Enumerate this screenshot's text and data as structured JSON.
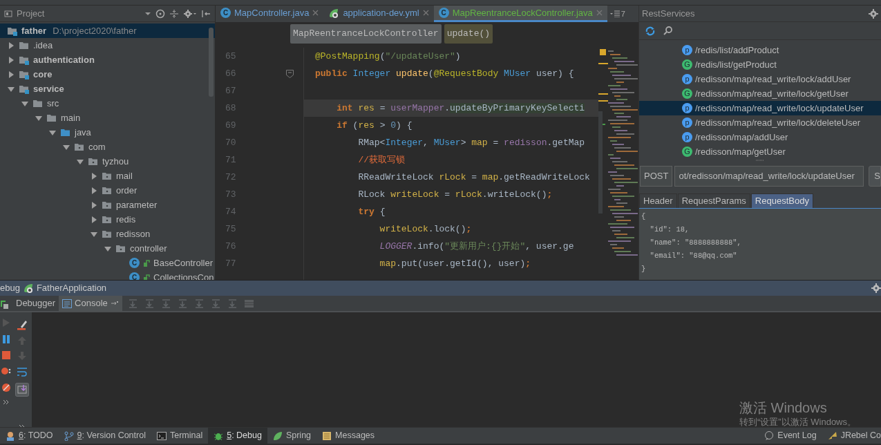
{
  "project_panel": {
    "title": "Project"
  },
  "tree": [
    {
      "label": "father",
      "path": "D:\\project2020\\father",
      "kind": "module",
      "selected": true,
      "children": [
        {
          "label": ".idea",
          "kind": "folder",
          "selected": false,
          "expanded": false
        },
        {
          "label": "authentication",
          "kind": "module",
          "selected": false,
          "expanded": false
        },
        {
          "label": "core",
          "kind": "module",
          "selected": false,
          "expanded": false
        },
        {
          "label": "service",
          "kind": "module",
          "selected": false,
          "expanded": true,
          "children": [
            {
              "label": "src",
              "kind": "folder",
              "selected": false,
              "expanded": true,
              "children": [
                {
                  "label": "main",
                  "kind": "folder",
                  "selected": false,
                  "expanded": true,
                  "children": [
                    {
                      "label": "java",
                      "kind": "source",
                      "selected": false,
                      "expanded": true,
                      "children": [
                        {
                          "label": "com",
                          "kind": "package",
                          "selected": false,
                          "expanded": true,
                          "children": [
                            {
                              "label": "tyzhou",
                              "kind": "package",
                              "selected": false,
                              "expanded": true,
                              "children": [
                                {
                                  "label": "mail",
                                  "kind": "package",
                                  "selected": false,
                                  "expanded": false
                                },
                                {
                                  "label": "order",
                                  "kind": "package",
                                  "selected": false,
                                  "expanded": false
                                },
                                {
                                  "label": "parameter",
                                  "kind": "package",
                                  "selected": false,
                                  "expanded": false
                                },
                                {
                                  "label": "redis",
                                  "kind": "package",
                                  "selected": false,
                                  "expanded": false
                                },
                                {
                                  "label": "redisson",
                                  "kind": "package",
                                  "selected": false,
                                  "expanded": true,
                                  "children": [
                                    {
                                      "label": "controller",
                                      "kind": "package",
                                      "selected": false,
                                      "expanded": true,
                                      "children": [
                                        {
                                          "label": "BaseController",
                                          "kind": "class",
                                          "badge": "C",
                                          "selected": false
                                        },
                                        {
                                          "label": "CollectionsCon",
                                          "kind": "class",
                                          "badge": "C",
                                          "selected": false
                                        }
                                      ]
                                    }
                                  ]
                                }
                              ]
                            }
                          ]
                        }
                      ]
                    }
                  ]
                }
              ]
            }
          ]
        }
      ]
    }
  ],
  "editor_tabs": [
    {
      "label": "MapController.java",
      "kind": "class",
      "badge": "C",
      "color": "#6a9fd4",
      "selected": false
    },
    {
      "label": "application-dev.yml",
      "kind": "spring",
      "color": "#6a9fd4",
      "selected": false
    },
    {
      "label": "MapReentranceLockController.java",
      "kind": "class",
      "badge": "C",
      "color": "#62b543",
      "selected": true
    }
  ],
  "tab_overflow_count": "7",
  "breadcrumbs": [
    {
      "label": "MapReentranceLockController",
      "kind": "class"
    },
    {
      "label": "update()",
      "kind": "method"
    }
  ],
  "code_lines": [
    {
      "number": "65",
      "current": false,
      "fold": false,
      "tokens": [
        {
          "text": "@PostMapping",
          "kind": "ann"
        },
        {
          "text": "(",
          "kind": "plain"
        },
        {
          "text": "\"/updateUser\"",
          "kind": "str"
        },
        {
          "text": ")",
          "kind": "plain"
        }
      ]
    },
    {
      "number": "66",
      "current": false,
      "fold": true,
      "tokens": [
        {
          "text": "public ",
          "kind": "kw"
        },
        {
          "text": "Integer ",
          "kind": "type"
        },
        {
          "text": "update",
          "kind": "method"
        },
        {
          "text": "(",
          "kind": "plain"
        },
        {
          "text": "@RequestBody ",
          "kind": "ann"
        },
        {
          "text": "MUser ",
          "kind": "type"
        },
        {
          "text": "user) {",
          "kind": "plain"
        }
      ]
    },
    {
      "number": "67",
      "current": false,
      "fold": false
    },
    {
      "number": "68",
      "current": true,
      "fold": false,
      "tokens": [
        {
          "text": "    int ",
          "kind": "kw"
        },
        {
          "text": "res",
          "kind": "var"
        },
        {
          "text": " = ",
          "kind": "plain"
        },
        {
          "text": "userMapper",
          "kind": "field"
        },
        {
          "text": ".",
          "kind": "plain"
        },
        {
          "text": "updateByPrimaryKeySelecti",
          "kind": "hl"
        }
      ]
    },
    {
      "number": "69",
      "current": false,
      "fold": false,
      "tokens": [
        {
          "text": "    if ",
          "kind": "kw"
        },
        {
          "text": "(",
          "kind": "plain"
        },
        {
          "text": "res",
          "kind": "var"
        },
        {
          "text": " > ",
          "kind": "plain"
        },
        {
          "text": "0",
          "kind": "num"
        },
        {
          "text": ") {",
          "kind": "plain"
        }
      ]
    },
    {
      "number": "70",
      "current": false,
      "fold": false,
      "tokens": [
        {
          "text": "        RMap<",
          "kind": "plain"
        },
        {
          "text": "Integer",
          "kind": "type"
        },
        {
          "text": ", ",
          "kind": "plain"
        },
        {
          "text": "MUser",
          "kind": "type"
        },
        {
          "text": "> ",
          "kind": "plain"
        },
        {
          "text": "map",
          "kind": "var"
        },
        {
          "text": " = ",
          "kind": "plain"
        },
        {
          "text": "redisson",
          "kind": "field"
        },
        {
          "text": ".getMap",
          "kind": "plain"
        }
      ]
    },
    {
      "number": "71",
      "current": false,
      "fold": false,
      "tokens": [
        {
          "text": "        //获取写锁",
          "kind": "comment"
        }
      ]
    },
    {
      "number": "72",
      "current": false,
      "fold": false,
      "tokens": [
        {
          "text": "        RReadWriteLock ",
          "kind": "plain"
        },
        {
          "text": "rLock",
          "kind": "var"
        },
        {
          "text": " = ",
          "kind": "plain"
        },
        {
          "text": "map",
          "kind": "var"
        },
        {
          "text": ".getReadWriteLock",
          "kind": "plain"
        }
      ]
    },
    {
      "number": "73",
      "current": false,
      "fold": false,
      "tokens": [
        {
          "text": "        RLock ",
          "kind": "plain"
        },
        {
          "text": "writeLock",
          "kind": "var"
        },
        {
          "text": " = ",
          "kind": "plain"
        },
        {
          "text": "rLock",
          "kind": "var"
        },
        {
          "text": ".writeLock()",
          "kind": "plain"
        },
        {
          "text": ";",
          "kind": "kw"
        }
      ]
    },
    {
      "number": "74",
      "current": false,
      "fold": false,
      "tokens": [
        {
          "text": "        try ",
          "kind": "kw"
        },
        {
          "text": "{",
          "kind": "plain"
        }
      ]
    },
    {
      "number": "75",
      "current": false,
      "fold": false,
      "tokens": [
        {
          "text": "            writeLock",
          "kind": "var"
        },
        {
          "text": ".lock()",
          "kind": "plain"
        },
        {
          "text": ";",
          "kind": "kw"
        }
      ]
    },
    {
      "number": "76",
      "current": false,
      "fold": false,
      "tokens": [
        {
          "text": "            LOGGER",
          "kind": "static"
        },
        {
          "text": ".info(",
          "kind": "plain"
        },
        {
          "text": "\"更新用户:{}开始\"",
          "kind": "str"
        },
        {
          "text": ", user.ge",
          "kind": "plain"
        }
      ]
    },
    {
      "number": "77",
      "current": false,
      "fold": false,
      "tokens": [
        {
          "text": "            map",
          "kind": "var"
        },
        {
          "text": ".put(user.getId(), user)",
          "kind": "plain"
        },
        {
          "text": ";",
          "kind": "kw"
        }
      ]
    }
  ],
  "rest_services": {
    "title": "RestServices",
    "endpoints": [
      {
        "kind": "post",
        "badge": "p",
        "path": "/redis/list/addProduct",
        "selected": false
      },
      {
        "kind": "get",
        "badge": "G",
        "path": "/redis/list/getProduct",
        "selected": false
      },
      {
        "kind": "post",
        "badge": "p",
        "path": "/redisson/map/read_write/lock/addUser",
        "selected": false
      },
      {
        "kind": "get",
        "badge": "G",
        "path": "/redisson/map/read_write/lock/getUser",
        "selected": false
      },
      {
        "kind": "post",
        "badge": "p",
        "path": "/redisson/map/read_write/lock/updateUser",
        "selected": true
      },
      {
        "kind": "post",
        "badge": "p",
        "path": "/redisson/map/read_write/lock/deleteUser",
        "selected": false
      },
      {
        "kind": "post",
        "badge": "p",
        "path": "/redisson/map/addUser",
        "selected": false
      },
      {
        "kind": "get",
        "badge": "G",
        "path": "/redisson/map/getUser",
        "selected": false
      }
    ],
    "request": {
      "method": "POST",
      "url": "ot/redisson/map/read_write/lock/updateUser",
      "send_label": "S"
    },
    "tabs": [
      {
        "label": "Header",
        "selected": false
      },
      {
        "label": "RequestParams",
        "selected": false
      },
      {
        "label": "RequestBody",
        "selected": true
      }
    ],
    "body": [
      "{",
      "  \"id\": 18,",
      "  \"name\": \"8888888888\",",
      "  \"email\": \"88@qq.com\"",
      "}"
    ]
  },
  "debug_panel": {
    "title": "ebug",
    "config": "FatherApplication",
    "tabs": [
      {
        "label": "Debugger",
        "selected": false
      },
      {
        "label": "Console",
        "selected": true
      }
    ]
  },
  "tool_windows": [
    {
      "mnemonic": "6",
      "label": ": TODO",
      "kind": "todo",
      "selected": false
    },
    {
      "mnemonic": "9",
      "label": ": Version Control",
      "kind": "vcs",
      "selected": false
    },
    {
      "label": "Terminal",
      "kind": "terminal",
      "selected": false
    },
    {
      "mnemonic": "5",
      "label": ": Debug",
      "kind": "debug",
      "selected": true
    },
    {
      "label": "Spring",
      "kind": "spring",
      "selected": false
    },
    {
      "label": "Messages",
      "kind": "messages",
      "selected": false
    }
  ],
  "status_right": [
    {
      "label": "Event Log",
      "kind": "event-log"
    },
    {
      "label": "JRebel Co",
      "kind": "jrebel"
    }
  ],
  "activation_notice": {
    "title": "激活 Windows",
    "hint": "转到“设置”以激活 Windows。"
  }
}
